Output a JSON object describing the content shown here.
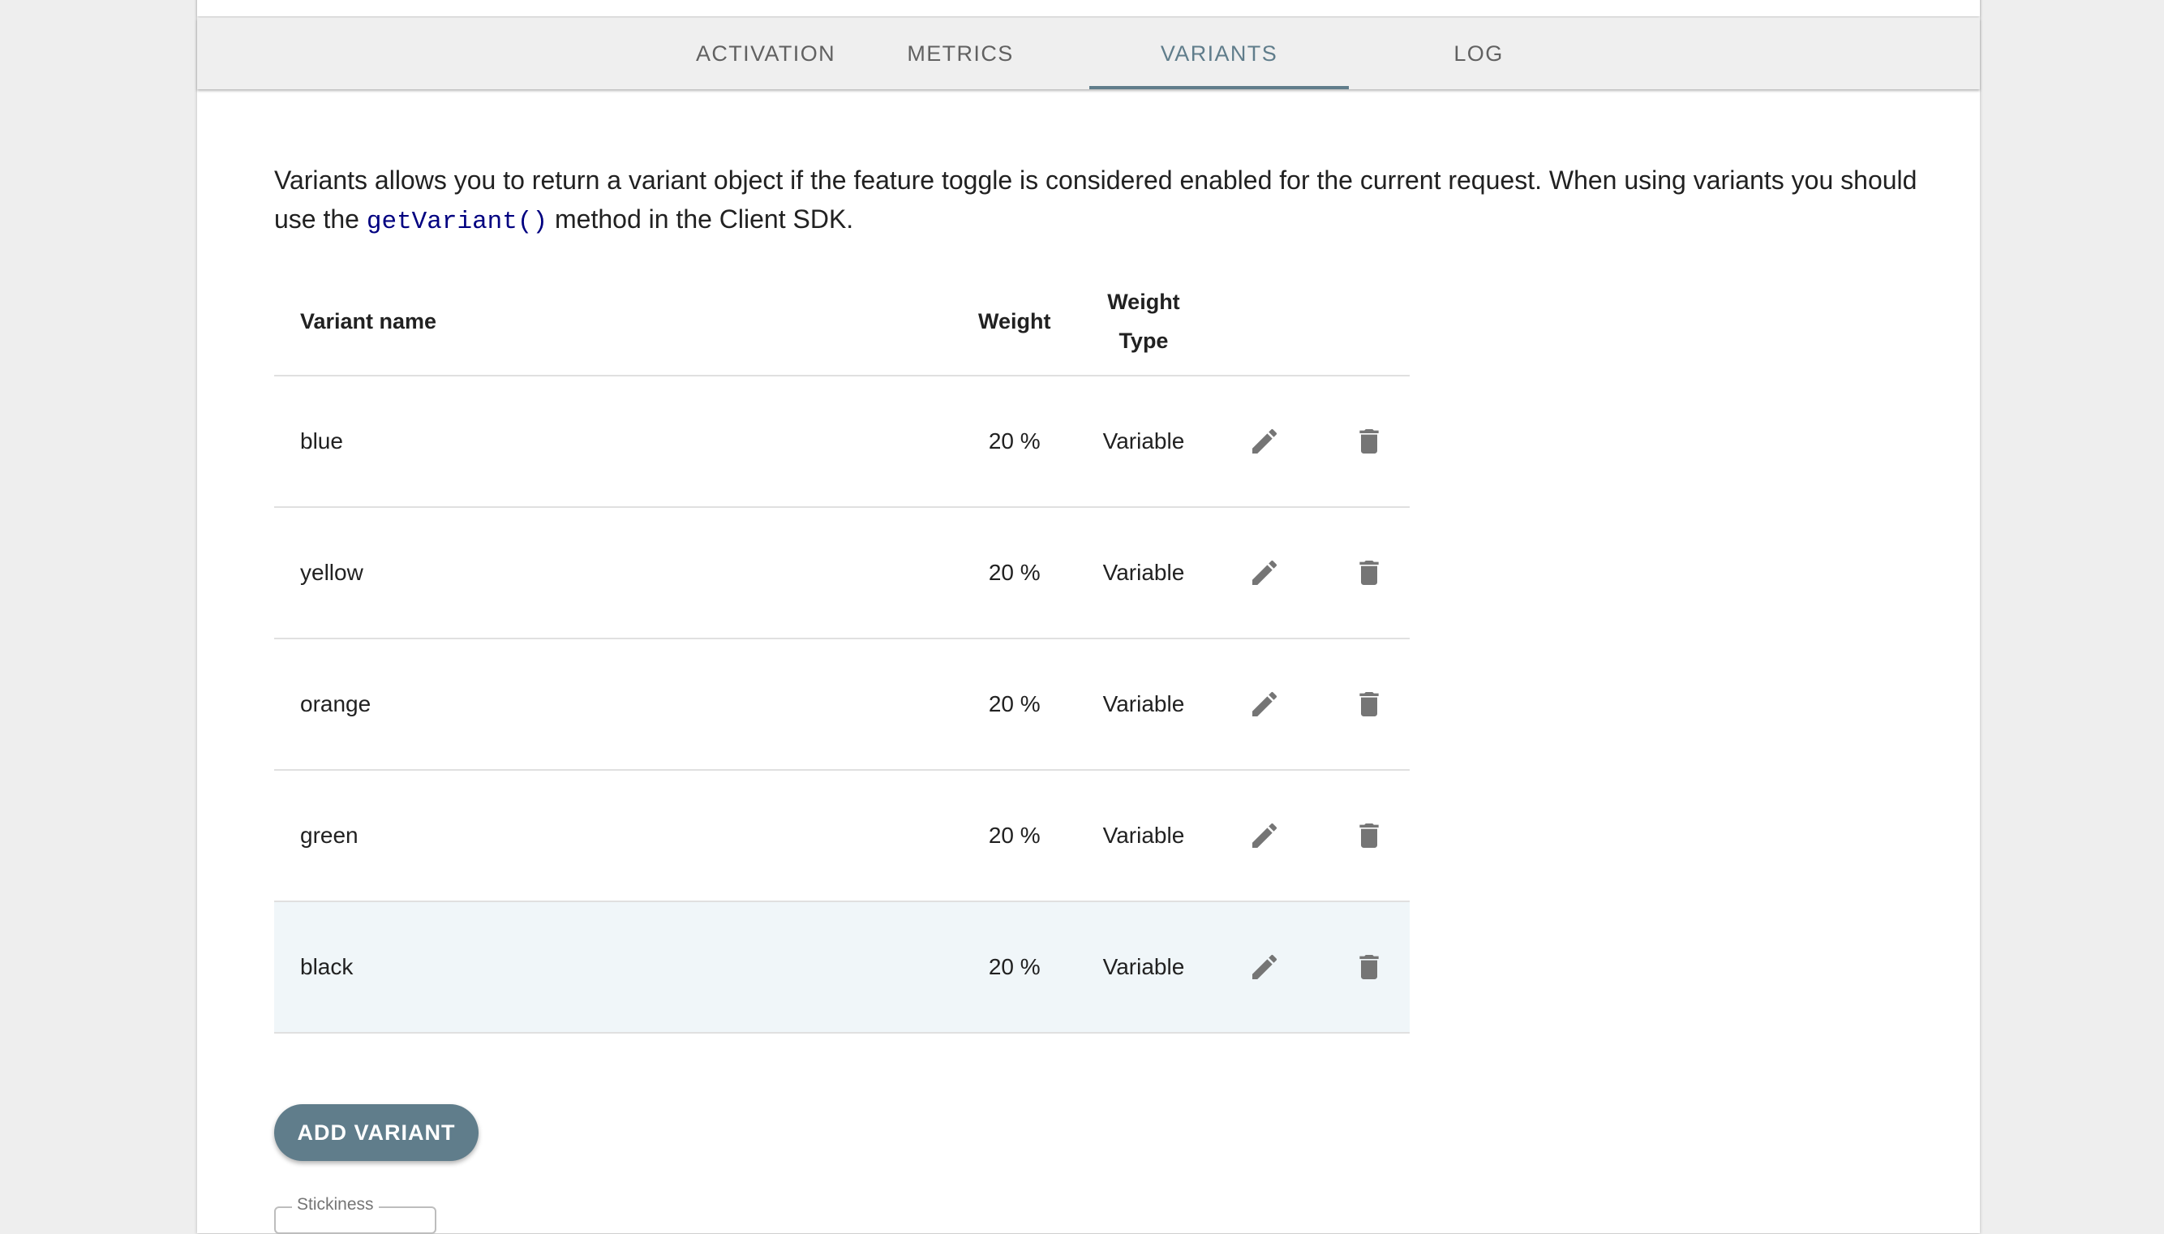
{
  "tabs": [
    {
      "label": "ACTIVATION"
    },
    {
      "label": "METRICS"
    },
    {
      "label": "VARIANTS"
    },
    {
      "label": "LOG"
    }
  ],
  "active_tab": "VARIANTS",
  "intro": {
    "before": "Variants allows you to return a variant object if the feature toggle is considered enabled for the current request. When using variants you should use the ",
    "code": "getVariant()",
    "after": " method in the Client SDK."
  },
  "table": {
    "headers": {
      "name": "Variant name",
      "weight": "Weight",
      "weight_type_line1": "Weight",
      "weight_type_line2": "Type"
    },
    "rows": [
      {
        "name": "blue",
        "weight": "20 %",
        "type": "Variable"
      },
      {
        "name": "yellow",
        "weight": "20 %",
        "type": "Variable"
      },
      {
        "name": "orange",
        "weight": "20 %",
        "type": "Variable"
      },
      {
        "name": "green",
        "weight": "20 %",
        "type": "Variable"
      },
      {
        "name": "black",
        "weight": "20 %",
        "type": "Variable"
      }
    ]
  },
  "add_button": "ADD VARIANT",
  "stickiness_label": "Stickiness",
  "colors": {
    "accent": "#607d8b",
    "highlight_row": "#f0f6f9",
    "code": "#000080",
    "icon": "#757575"
  },
  "icons": {
    "edit": "pencil-icon",
    "delete": "trash-icon"
  }
}
